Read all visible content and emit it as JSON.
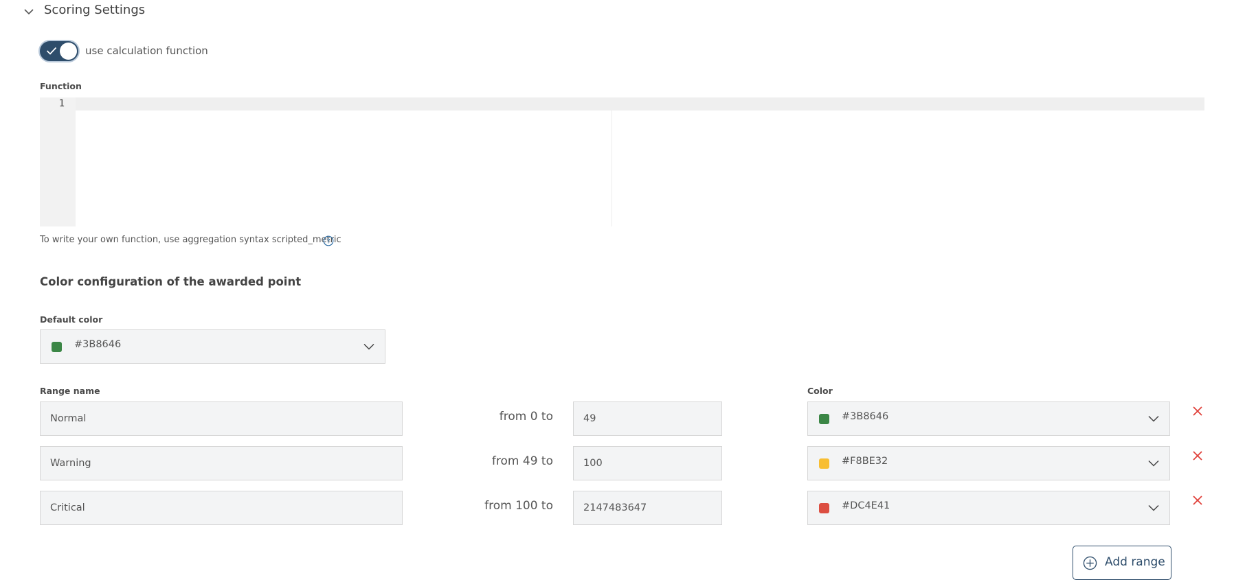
{
  "section": {
    "title": "Scoring Settings",
    "expanded_icon": "chevron-down-icon"
  },
  "toggle": {
    "label": "use calculation function",
    "checked": true
  },
  "function_editor": {
    "label": "Function",
    "line_numbers": [
      "1"
    ],
    "code": ""
  },
  "hint": {
    "text": "To write your own function, use aggregation syntax scripted_metric",
    "icon": "help-icon"
  },
  "color_config": {
    "title": "Color configuration of the awarded point"
  },
  "default_color": {
    "label": "Default color",
    "value": "#3B8646",
    "swatch": "#3B8646"
  },
  "ranges": {
    "name_label": "Range name",
    "color_label": "Color",
    "items": [
      {
        "name": "Normal",
        "from_text": "from 0 to",
        "to": "49",
        "color": "#3B8646",
        "swatch": "#3B8646"
      },
      {
        "name": "Warning",
        "from_text": "from 49 to",
        "to": "100",
        "color": "#F8BE32",
        "swatch": "#F8BE32"
      },
      {
        "name": "Critical",
        "from_text": "from 100 to",
        "to": "2147483647",
        "color": "#DC4E41",
        "swatch": "#DC4E41"
      }
    ]
  },
  "add_range": {
    "label": "Add range",
    "icon": "plus-circle-icon"
  },
  "colors": {
    "accent": "#2E4D6B",
    "remove": "#E0403A"
  }
}
